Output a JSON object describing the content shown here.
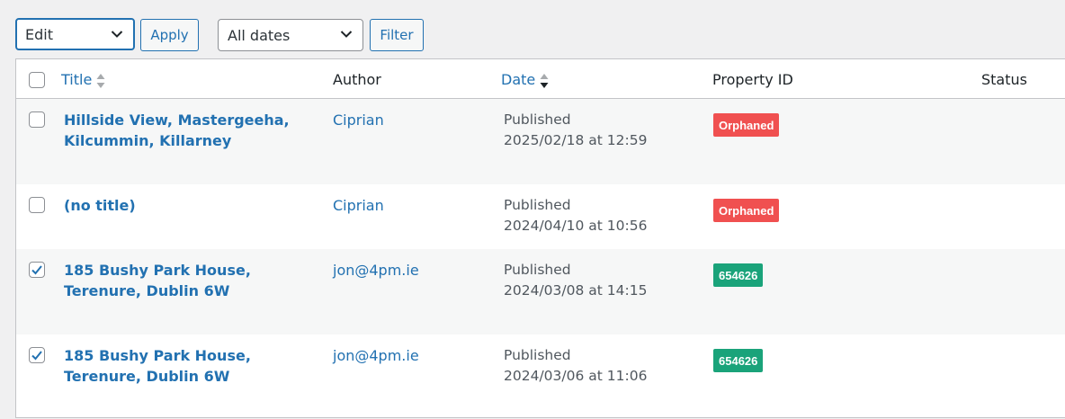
{
  "toolbar": {
    "bulk_action": {
      "selected": "Edit"
    },
    "apply_label": "Apply",
    "date_filter": {
      "selected": "All dates"
    },
    "filter_label": "Filter"
  },
  "table": {
    "columns": {
      "title": "Title",
      "author": "Author",
      "date": "Date",
      "property_id": "Property ID",
      "status": "Status"
    },
    "rows": [
      {
        "checked": false,
        "title": "Hillside View, Mastergeeha, Kilcummin, Killarney",
        "author": "Ciprian",
        "date_status": "Published",
        "date_value": "2025/02/18 at 12:59",
        "property_id": "Orphaned",
        "badge_color": "#f05050"
      },
      {
        "checked": false,
        "title": "(no title)",
        "author": "Ciprian",
        "date_status": "Published",
        "date_value": "2024/04/10 at 10:56",
        "property_id": "Orphaned",
        "badge_color": "#f05050"
      },
      {
        "checked": true,
        "title": "185 Bushy Park House, Terenure, Dublin 6W",
        "author": "jon@4pm.ie",
        "date_status": "Published",
        "date_value": "2024/03/08 at 14:15",
        "property_id": "654626",
        "badge_color": "#1aa37a"
      },
      {
        "checked": true,
        "title": "185 Bushy Park House, Terenure, Dublin 6W",
        "author": "jon@4pm.ie",
        "date_status": "Published",
        "date_value": "2024/03/06 at 11:06",
        "property_id": "654626",
        "badge_color": "#1aa37a"
      }
    ]
  },
  "icons": {
    "select_arrow": "chevron-down-icon",
    "sort_both": "sort-icon",
    "sort_desc": "sort-desc-icon",
    "check": "checkmark-icon"
  },
  "colors": {
    "link": "#2271b1",
    "orphaned": "#f05050",
    "id_badge": "#1aa37a"
  }
}
